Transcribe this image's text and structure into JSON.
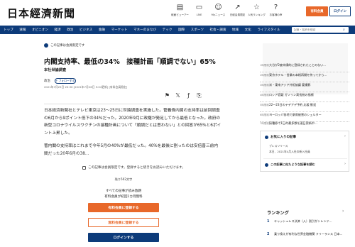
{
  "header": {
    "logo": "日本經濟新聞",
    "icons": [
      {
        "icon": "newspaper-icon",
        "label": "紙面ビューアー"
      },
      {
        "icon": "tv-icon",
        "label": "LIVE"
      },
      {
        "icon": "person-icon",
        "label": "Myニュース"
      },
      {
        "icon": "trend-icon",
        "label": "日経会員限定"
      },
      {
        "icon": "star-icon",
        "label": "人気ランキング"
      },
      {
        "icon": "help-icon",
        "label": "お客様の声"
      }
    ],
    "subscribe_label": "有料会員",
    "login_label": "ログイン"
  },
  "nav": {
    "items": [
      "トップ",
      "速報",
      "オピニオン",
      "経済",
      "政治",
      "ビジネス",
      "金融",
      "マーケット",
      "マネーのまなび",
      "テック",
      "国際",
      "スポーツ",
      "社会・調査",
      "地域",
      "文化",
      "ライフスタイル"
    ],
    "search_placeholder": "記事・銘柄を検索"
  },
  "article": {
    "members_label": "この記事は会員限定です",
    "title": "内閣支持率、最低の34%　接種計画「順調でない」65%",
    "byline": "本社世論調査",
    "tag": "政治",
    "follow_label": "+ フォローする",
    "date": "2021年7月25日 20:30 [2021年7月26日 5:04更新] [有料会員限定]",
    "share_icons": [
      "bookmark-icon",
      "twitter-icon",
      "facebook-icon",
      "link-icon"
    ],
    "paragraph1": "日本経済新聞社とテレビ東京は23～25日に世論調査を実施した。菅義偉内閣の支持率は前回調査の6月から9ポイント低下の34%だった。2020年9月に政権が発足してから最低となった。政府の新型コロナウイルスワクチンの接種計画について「順調だとは思わない」との回答が65%と6ポイント上昇した。",
    "paragraph2": "菅内閣の支持率はこれまで今年5月の40%が最低だった。40%を最後に割ったのは安倍晋三前内閣だった20年6月の38..."
  },
  "paywall": {
    "notice": "この記事は会員限定です。登録すると続きをお読みいただけます。",
    "remaining": "残り502文字",
    "line1": "すべての記事が読み放題",
    "line2": "有料会員が初回1カ月無料",
    "paid_button": "有料会員に登録する",
    "free_button": "無料会員に登録する",
    "login_button": "ログインする"
  },
  "sidebar": {
    "news": [
      {
        "time": "1時間前",
        "text": "大谷が2度申請的に登録されたことのない..."
      },
      {
        "time": "2時間前",
        "text": "東京ホテル・営業の本格再開を待ってから..."
      },
      {
        "time": "3時間前",
        "text": "米・東南アジア外相協議 要撮影"
      },
      {
        "time": "4時間前",
        "text": "ロシア容疑 ガソリン高長統の指標"
      },
      {
        "time": "5時間前",
        "text": "22～23日のテデアデ予約 応援 歓迎"
      },
      {
        "time": "6時間前",
        "text": "ヨーロッパ各地で豪雨被害のシェルター"
      },
      {
        "time": "7時間前",
        "text": "接種券で1日の最多数を連日更新中..."
      }
    ],
    "mynews": {
      "title": "お気に入りの記事",
      "sub1": "プレスリリース",
      "sub2": "本日、2021年4月入社の新入社員",
      "footer": "この記事に似たような記事を読む"
    },
    "ranking_title": "ランキング",
    "ranking": [
      {
        "num": "1",
        "text": "キャッシュレス決済（入）割引がトレンド..."
      },
      {
        "num": "2",
        "text": "乗り換えが有利な世界金融機関 フリーランス 日本..."
      }
    ]
  }
}
